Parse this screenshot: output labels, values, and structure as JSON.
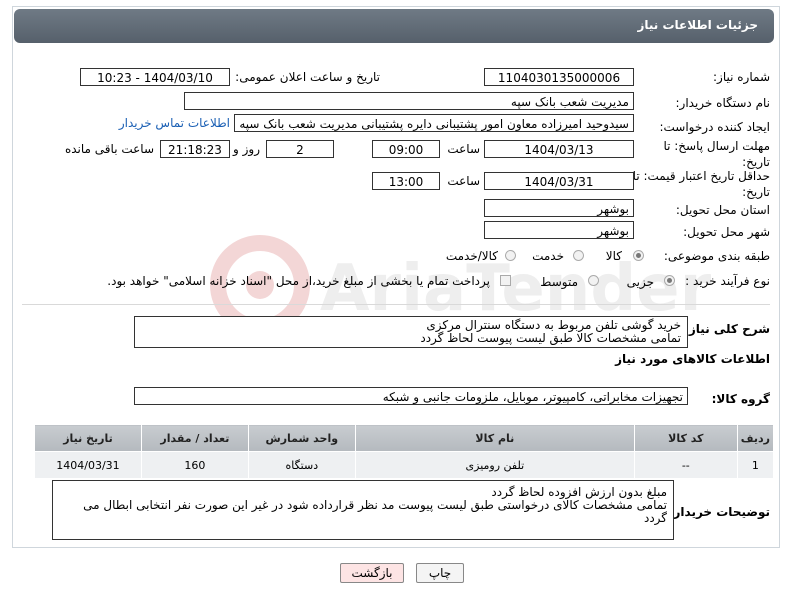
{
  "header": {
    "title": "جزئیات اطلاعات نیاز"
  },
  "fields": {
    "need_number": {
      "label": "شماره نیاز:",
      "value": "1104030135000006"
    },
    "announce": {
      "label": "تاریخ و ساعت اعلان عمومی:",
      "value": "1404/03/10 - 10:23"
    },
    "buyer_org": {
      "label": "نام دستگاه خریدار:",
      "value": "مدیریت شعب بانک سپه"
    },
    "requester": {
      "label": "ایجاد کننده درخواست:",
      "value": "سیدوحید امیرزاده معاون امور پشتیبانی دایره پشتیبانی مدیریت شعب بانک سپه",
      "contact_link": "اطلاعات تماس خریدار"
    },
    "deadline": {
      "label": "مهلت ارسال پاسخ: تا تاریخ:",
      "date": "1404/03/13",
      "time_label": "ساعت",
      "time": "09:00",
      "days": "2",
      "days_label": "روز و",
      "remaining": "21:18:23",
      "remaining_label": "ساعت باقی مانده"
    },
    "price_validity": {
      "label": "حداقل تاریخ اعتبار قیمت: تا تاریخ:",
      "date": "1404/03/31",
      "time_label": "ساعت",
      "time": "13:00"
    },
    "province": {
      "label": "استان محل تحویل:",
      "value": "بوشهر"
    },
    "city": {
      "label": "شهر محل تحویل:",
      "value": "بوشهر"
    },
    "category": {
      "label": "طبقه بندی موضوعی:",
      "options": [
        "کالا",
        "خدمت",
        "کالا/خدمت"
      ],
      "selected": "کالا"
    },
    "process": {
      "label": "نوع فرآیند خرید :",
      "options": [
        "جزیی",
        "متوسط"
      ],
      "selected": "جزیی",
      "note": "پرداخت تمام یا بخشی از مبلغ خرید،از محل \"اسناد خزانه اسلامی\" خواهد بود."
    }
  },
  "description": {
    "label": "شرح کلی نیاز:",
    "text": "خرید گوشی تلفن مربوط به دستگاه سنترال مرکزی\nتمامی مشخصات کالا طبق لیست  پیوست لحاظ گردد"
  },
  "goods_info": {
    "title": "اطلاعات کالاهای مورد نیاز",
    "group_label": "گروه کالا:",
    "group_value": "تجهیزات مخابراتی، کامپیوتر، موبایل، ملزومات جانبی و شبکه"
  },
  "table": {
    "headers": [
      "ردیف",
      "کد کالا",
      "نام کالا",
      "واحد شمارش",
      "تعداد / مقدار",
      "تاریخ نیاز"
    ],
    "rows": [
      [
        "1",
        "--",
        "تلفن رومیزی",
        "دستگاه",
        "160",
        "1404/03/31"
      ]
    ]
  },
  "buyer_notes": {
    "label": "توضیحات خریدار:",
    "text": "مبلغ بدون ارزش افزوده لحاظ گردد\nتمامی مشخصات کالای درخواستی طبق لیست پیوست مد نظر قرارداده شود در غیر این صورت نفر انتخابی ابطال می گردد"
  },
  "buttons": {
    "print": "چاپ",
    "back": "بازگشت"
  },
  "colors": {
    "header_bg": "#5f6a75",
    "link": "#1a5fb4",
    "back_button_bg": "#fde4e4"
  }
}
